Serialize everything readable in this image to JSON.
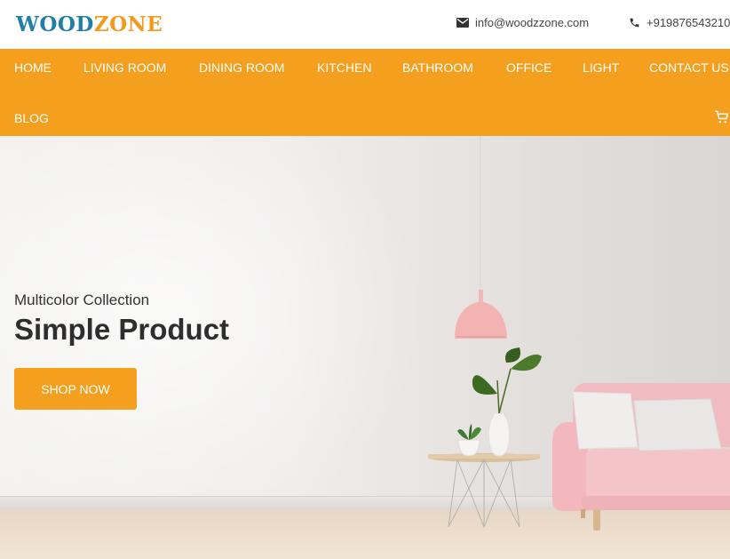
{
  "brand": {
    "logo_part1": "WOOD",
    "logo_part2": "ZONE"
  },
  "contact": {
    "email": "info@woodzzone.com",
    "phone": "+919876543210"
  },
  "nav": {
    "items": [
      {
        "label": "HOME"
      },
      {
        "label": "LIVING ROOM"
      },
      {
        "label": "DINING ROOM"
      },
      {
        "label": "KITCHEN"
      },
      {
        "label": "BATHROOM"
      },
      {
        "label": "OFFICE"
      },
      {
        "label": "LIGHT"
      },
      {
        "label": "CONTACT US"
      },
      {
        "label": "BLOG"
      }
    ]
  },
  "hero": {
    "subtitle": "Multicolor Collection",
    "title": "Simple Product",
    "cta_label": "SHOP NOW"
  },
  "colors": {
    "accent": "#f59f1f",
    "logo_blue": "#1f7fa6",
    "logo_orange": "#f39a1e"
  },
  "icons": {
    "email": "envelope-icon",
    "phone": "phone-icon",
    "cart": "cart-icon"
  }
}
